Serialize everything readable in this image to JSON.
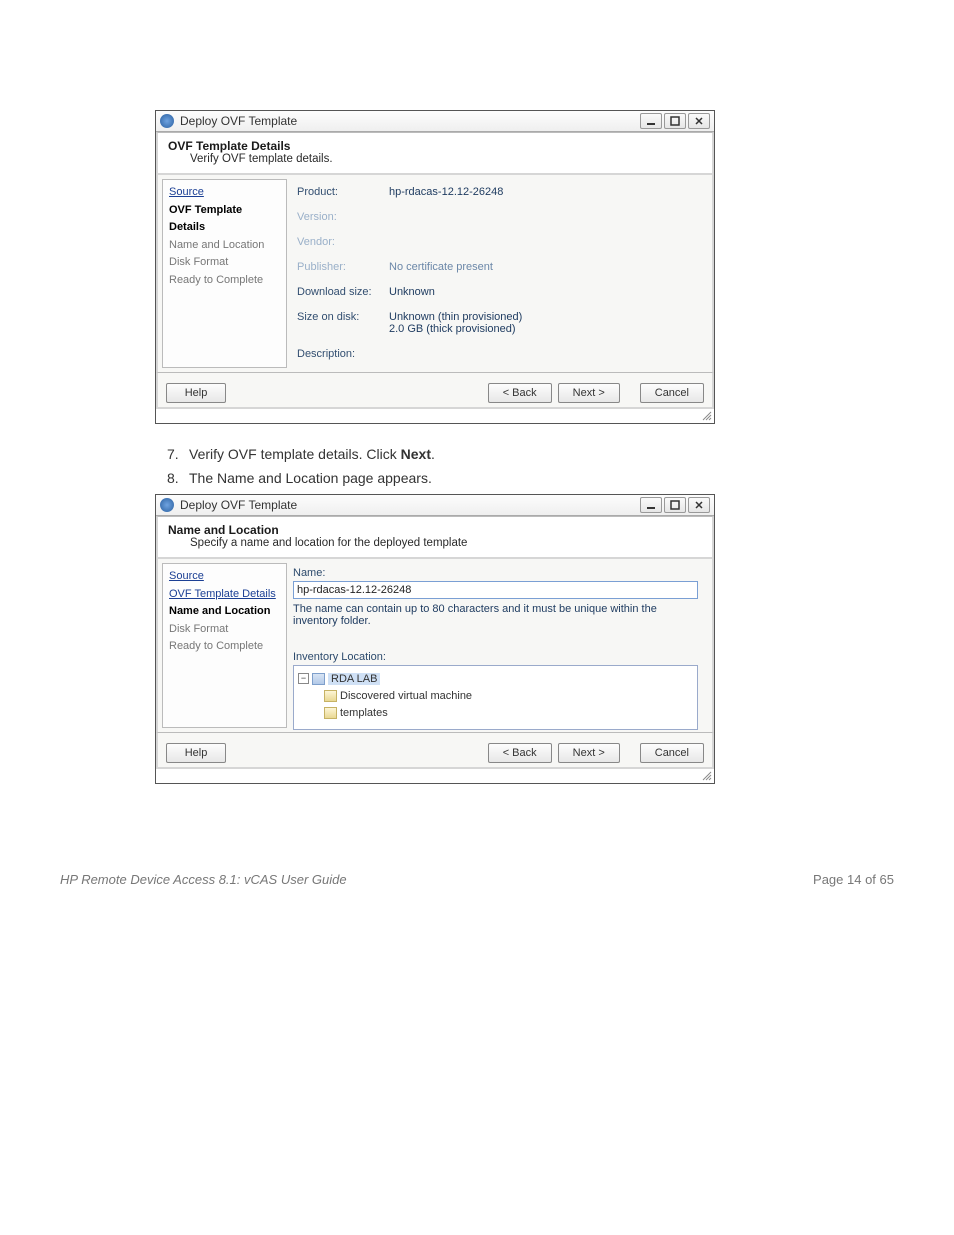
{
  "dialog1": {
    "title": "Deploy OVF Template",
    "header_title": "OVF Template Details",
    "header_sub": "Verify OVF template details.",
    "steps": {
      "source": "Source",
      "details": "OVF Template Details",
      "nameloc": "Name and Location",
      "diskformat": "Disk Format",
      "ready": "Ready to Complete"
    },
    "fields": {
      "product_label": "Product:",
      "product_value": "hp-rdacas-12.12-26248",
      "version_label": "Version:",
      "vendor_label": "Vendor:",
      "publisher_label": "Publisher:",
      "publisher_value": "No certificate present",
      "download_label": "Download size:",
      "download_value": "Unknown",
      "sizeondisk_label": "Size on disk:",
      "sizeondisk_value_l1": "Unknown (thin provisioned)",
      "sizeondisk_value_l2": "2.0 GB (thick provisioned)",
      "description_label": "Description:"
    },
    "buttons": {
      "help": "Help",
      "back": "< Back",
      "next": "Next >",
      "cancel": "Cancel"
    }
  },
  "instructions": {
    "step7": "Verify OVF template details. Click ",
    "step7_bold": "Next",
    "step7_end": ".",
    "step8": "The Name and Location page appears."
  },
  "dialog2": {
    "title": "Deploy OVF Template",
    "header_title": "Name and Location",
    "header_sub": "Specify a name and location for the deployed template",
    "steps": {
      "source": "Source",
      "details": "OVF Template Details",
      "nameloc": "Name and Location",
      "diskformat": "Disk Format",
      "ready": "Ready to Complete"
    },
    "name_label": "Name:",
    "name_value": "hp-rdacas-12.12-26248",
    "name_hint": "The name can contain up to 80 characters and it must be unique within the inventory folder.",
    "inv_label": "Inventory Location:",
    "tree": {
      "root": "RDA LAB",
      "child1": "Discovered virtual machine",
      "child2": "templates"
    },
    "buttons": {
      "help": "Help",
      "back": "< Back",
      "next": "Next >",
      "cancel": "Cancel"
    }
  },
  "footer": {
    "left": "HP Remote Device Access 8.1: vCAS User Guide",
    "right": "Page 14 of 65"
  }
}
